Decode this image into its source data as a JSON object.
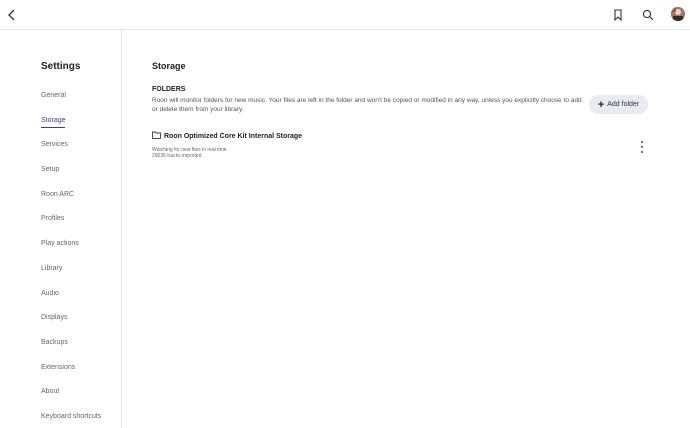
{
  "topbar": {
    "icons": [
      "back-arrow-icon",
      "bookmark-icon",
      "search-icon",
      "avatar"
    ]
  },
  "sidebar": {
    "title": "Settings",
    "items": [
      {
        "label": "General"
      },
      {
        "label": "Storage",
        "active": true
      },
      {
        "label": "Services"
      },
      {
        "label": "Setup"
      },
      {
        "label": "Roon ARC"
      },
      {
        "label": "Profiles"
      },
      {
        "label": "Play actions"
      },
      {
        "label": "Library"
      },
      {
        "label": "Audio"
      },
      {
        "label": "Displays"
      },
      {
        "label": "Backups"
      },
      {
        "label": "Extensions"
      },
      {
        "label": "About"
      },
      {
        "label": "Keyboard shortcuts"
      }
    ]
  },
  "main": {
    "title": "Storage",
    "folders_section": {
      "heading": "FOLDERS",
      "description": "Roon will monitor folders for new music. Your files are left in the folder and won't be copied or modified in any way, unless you explicitly choose to add or delete them from your library.",
      "add_button_label": "Add folder"
    },
    "folder": {
      "name": "Roon Optimized Core Kit Internal Storage",
      "status": "Watching for new files in real time",
      "count": "29035 tracks imported"
    }
  },
  "colors": {
    "accent": "#3b3f9c",
    "button_bg": "#e8ebf1",
    "divider": "#e4e4e4"
  }
}
